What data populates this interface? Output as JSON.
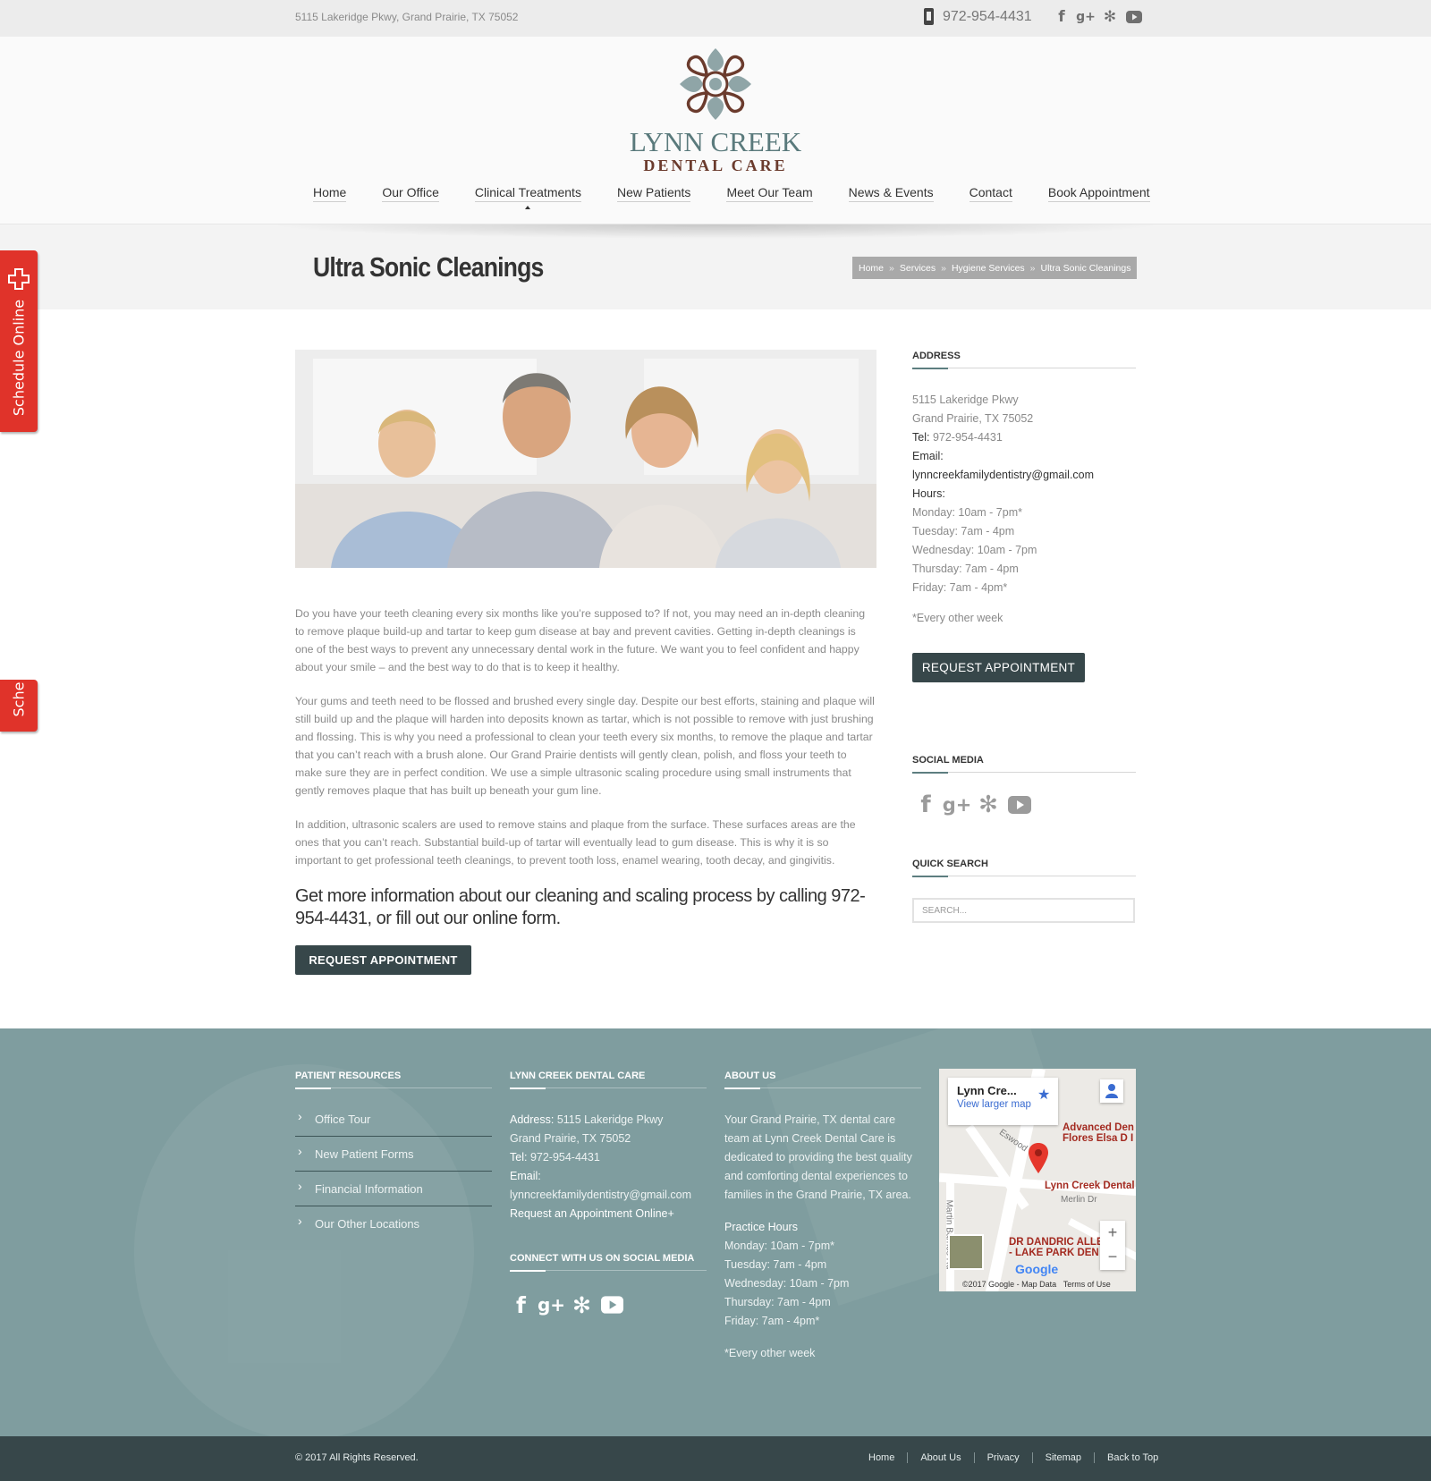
{
  "topbar": {
    "address": "5115 Lakeridge Pkwy, Grand Prairie, TX 75052",
    "phone": "972-954-4431",
    "socials": [
      "facebook-icon",
      "google-plus-icon",
      "yelp-icon",
      "youtube-icon"
    ]
  },
  "logo": {
    "line1": "LYNN CREEK",
    "line2": "DENTAL CARE"
  },
  "nav": [
    "Home",
    "Our Office",
    "Clinical Treatments",
    "New Patients",
    "Meet Our Team",
    "News & Events",
    "Contact",
    "Book Appointment"
  ],
  "schedule_tab": {
    "label": "Schedule Online",
    "label_cut": "Sche"
  },
  "page": {
    "title": "Ultra Sonic Cleanings",
    "breadcrumb": [
      "Home",
      "Services",
      "Hygiene Services",
      "Ultra Sonic Cleanings"
    ],
    "breadcrumb_sep": "»"
  },
  "content": {
    "p1": "Do you have your teeth cleaning every six months like you’re supposed to? If not, you may need an in-depth cleaning to remove plaque build-up and tartar to keep gum disease at bay and prevent cavities. Getting in-depth cleanings is one of the best ways to prevent any unnecessary dental work in the future. We want you to feel confident and happy about your smile – and the best way to do that is to keep it healthy.",
    "p2": "Your gums and teeth need to be flossed and brushed every single day. Despite our best efforts, staining and plaque will still build up and the plaque will harden into deposits known as tartar, which is not possible to remove with just brushing and flossing. This is why you need a professional to clean your teeth every six months, to remove the plaque and tartar that you can’t reach with a brush alone. Our Grand Prairie dentists will gently clean, polish, and floss your teeth to make sure they are in perfect condition. We use a simple ultrasonic scaling procedure using small instruments that gently removes plaque that has built up beneath your gum line.",
    "p3": "In addition, ultrasonic scalers are used to remove stains and plaque from the surface. These surfaces areas are the ones that you can’t reach. Substantial build-up of tartar will eventually lead to gum disease. This is why it is so important to get professional teeth cleanings, to prevent tooth loss, enamel wearing, tooth decay, and gingivitis.",
    "cta": "Get more information about our cleaning and scaling process by calling 972-954-4431, or fill out our online form.",
    "button": "REQUEST APPOINTMENT"
  },
  "sidebar": {
    "address_heading": "ADDRESS",
    "address1": "5115 Lakeridge Pkwy",
    "address2": "Grand Prairie, TX 75052",
    "tel_label": "Tel:",
    "tel": "972-954-4431",
    "email_label": "Email:",
    "email": "lynncreekfamilydentistry@gmail.com",
    "hours_label": "Hours:",
    "hours": [
      "Monday: 10am - 7pm*",
      "Tuesday: 7am - 4pm",
      "Wednesday: 10am - 7pm",
      "Thursday: 7am - 4pm",
      "Friday: 7am - 4pm*"
    ],
    "note": "*Every other week",
    "button": "REQUEST APPOINTMENT",
    "social_heading": "SOCIAL MEDIA",
    "search_heading": "QUICK SEARCH",
    "search_placeholder": "SEARCH..."
  },
  "footer": {
    "resources_heading": "PATIENT RESOURCES",
    "resources": [
      "Office Tour",
      "New Patient Forms",
      "Financial Information",
      "Our Other Locations"
    ],
    "care_heading": "LYNN CREEK DENTAL CARE",
    "address_label": "Address:",
    "address1": "5115 Lakeridge Pkwy",
    "address2": "Grand Prairie, TX 75052",
    "tel_label": "Tel:",
    "tel": "972-954-4431",
    "email_label": "Email:",
    "email": "lynncreekfamilydentistry@gmail.com",
    "request_link": "Request an Appointment Online+",
    "connect_heading": "CONNECT WITH US ON SOCIAL MEDIA",
    "about_heading": "ABOUT US",
    "about_text": "Your Grand Prairie, TX dental care team at Lynn Creek Dental Care is dedicated to providing the best quality and comforting dental experiences to families in the Grand Prairie, TX area.",
    "practice_hours_label": "Practice Hours",
    "hours": [
      "Monday: 10am - 7pm*",
      "Tuesday: 7am - 4pm",
      "Wednesday: 10am - 7pm",
      "Thursday: 7am - 4pm",
      "Friday: 7am - 4pm*"
    ],
    "note": "*Every other week"
  },
  "map": {
    "card_title": "Lynn Cre...",
    "card_link": "View larger map",
    "label_advanced": "Advanced Den\nFlores Elsa D I",
    "label_lynn": "Lynn Creek Dental",
    "label_dandric": "DR DANDRIC ALLE\n- LAKE PARK DEN",
    "street_merlin": "Merlin Dr",
    "street_martin": "Martin Barnes Rd",
    "street_wood": "Eswood",
    "google": "Google",
    "attribution": "©2017 Google - Map Data",
    "terms": "Terms of Use",
    "zoom_in": "+",
    "zoom_out": "−"
  },
  "bottom": {
    "copyright": "© 2017 All Rights Reserved.",
    "links": [
      "Home",
      "About Us",
      "Privacy",
      "Sitemap",
      "Back to Top"
    ]
  },
  "colors": {
    "accent_dark": "#37474a",
    "teal": "#7f9d9f",
    "schedule_red": "#e0332a",
    "brand_brown": "#6b3b2d"
  }
}
